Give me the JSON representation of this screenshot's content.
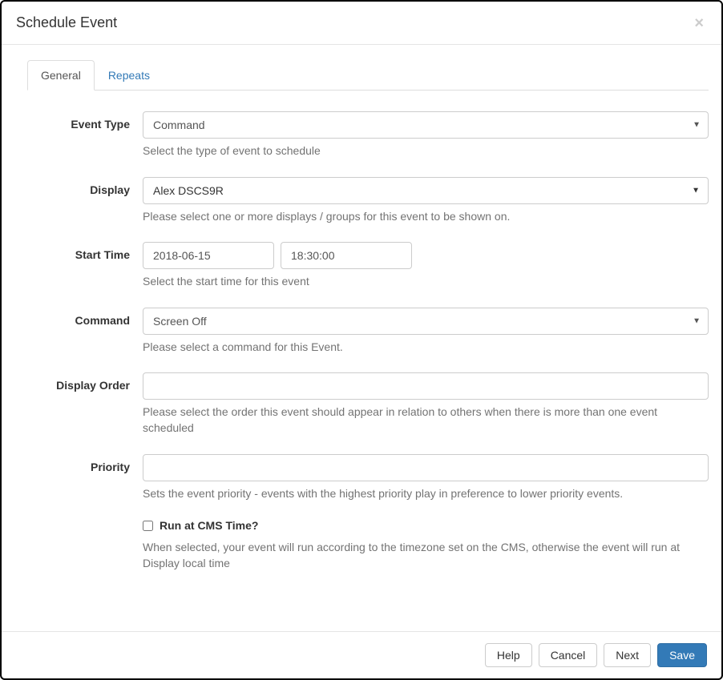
{
  "header": {
    "title": "Schedule Event",
    "close_label": "×"
  },
  "tabs": [
    {
      "label": "General",
      "active": true
    },
    {
      "label": "Repeats",
      "active": false
    }
  ],
  "form": {
    "event_type": {
      "label": "Event Type",
      "value": "Command",
      "help": "Select the type of event to schedule"
    },
    "display": {
      "label": "Display",
      "value": "Alex DSCS9R",
      "help": "Please select one or more displays / groups for this event to be shown on."
    },
    "start_time": {
      "label": "Start Time",
      "date": "2018-06-15",
      "time": "18:30:00",
      "help": "Select the start time for this event"
    },
    "command": {
      "label": "Command",
      "value": "Screen Off",
      "help": "Please select a command for this Event."
    },
    "display_order": {
      "label": "Display Order",
      "value": "",
      "help": "Please select the order this event should appear in relation to others when there is more than one event scheduled"
    },
    "priority": {
      "label": "Priority",
      "value": "",
      "help": "Sets the event priority - events with the highest priority play in preference to lower priority events."
    },
    "cms_time": {
      "label": "Run at CMS Time?",
      "checked": false,
      "help": "When selected, your event will run according to the timezone set on the CMS, otherwise the event will run at Display local time"
    }
  },
  "footer": {
    "help": "Help",
    "cancel": "Cancel",
    "next": "Next",
    "save": "Save"
  }
}
